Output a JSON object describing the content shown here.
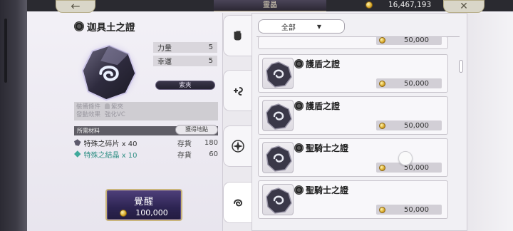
{
  "header": {
    "title": "靈晶",
    "currency_amount": "16,467,193"
  },
  "detail": {
    "name": "迦具土之證",
    "stats": [
      {
        "label": "力量",
        "value": "5"
      },
      {
        "label": "幸運",
        "value": "5"
      }
    ],
    "rarity": "紫夾",
    "equip_condition_label": "裝備條件",
    "equip_condition_value": "紫夾",
    "effect_label": "發動效果",
    "effect_value": "強化VC",
    "materials_header": "所需材料",
    "obtain_button": "獲得地點",
    "materials": [
      {
        "name": "特殊之碎片 x 40",
        "stock_label": "存貨",
        "stock": "180",
        "color": "#333333"
      },
      {
        "name": "特殊之結晶 x 10",
        "stock_label": "存貨",
        "stock": "60",
        "color": "#2f8f84"
      }
    ],
    "awaken_label": "覺醒",
    "awaken_cost": "100,000"
  },
  "filter": {
    "selected": "全部"
  },
  "cards": [
    {
      "name": "",
      "price": "50,000"
    },
    {
      "name": "護盾之證",
      "price": "50,000"
    },
    {
      "name": "護盾之證",
      "price": "50,000"
    },
    {
      "name": "聖騎士之證",
      "price": "50,000"
    },
    {
      "name": "聖騎士之證",
      "price": "50,000"
    }
  ],
  "icons": {
    "back": "back-arrow-icon",
    "close": "close-icon",
    "coin": "coin-icon",
    "tabs": [
      "fist-icon",
      "plus-swirl-icon",
      "sparkle-emblem-icon",
      "spiral-icon"
    ]
  },
  "colors": {
    "accent_gold": "#c9b47a",
    "awaken_purple": "#2d2452",
    "crystal_green": "#2f8f84"
  }
}
